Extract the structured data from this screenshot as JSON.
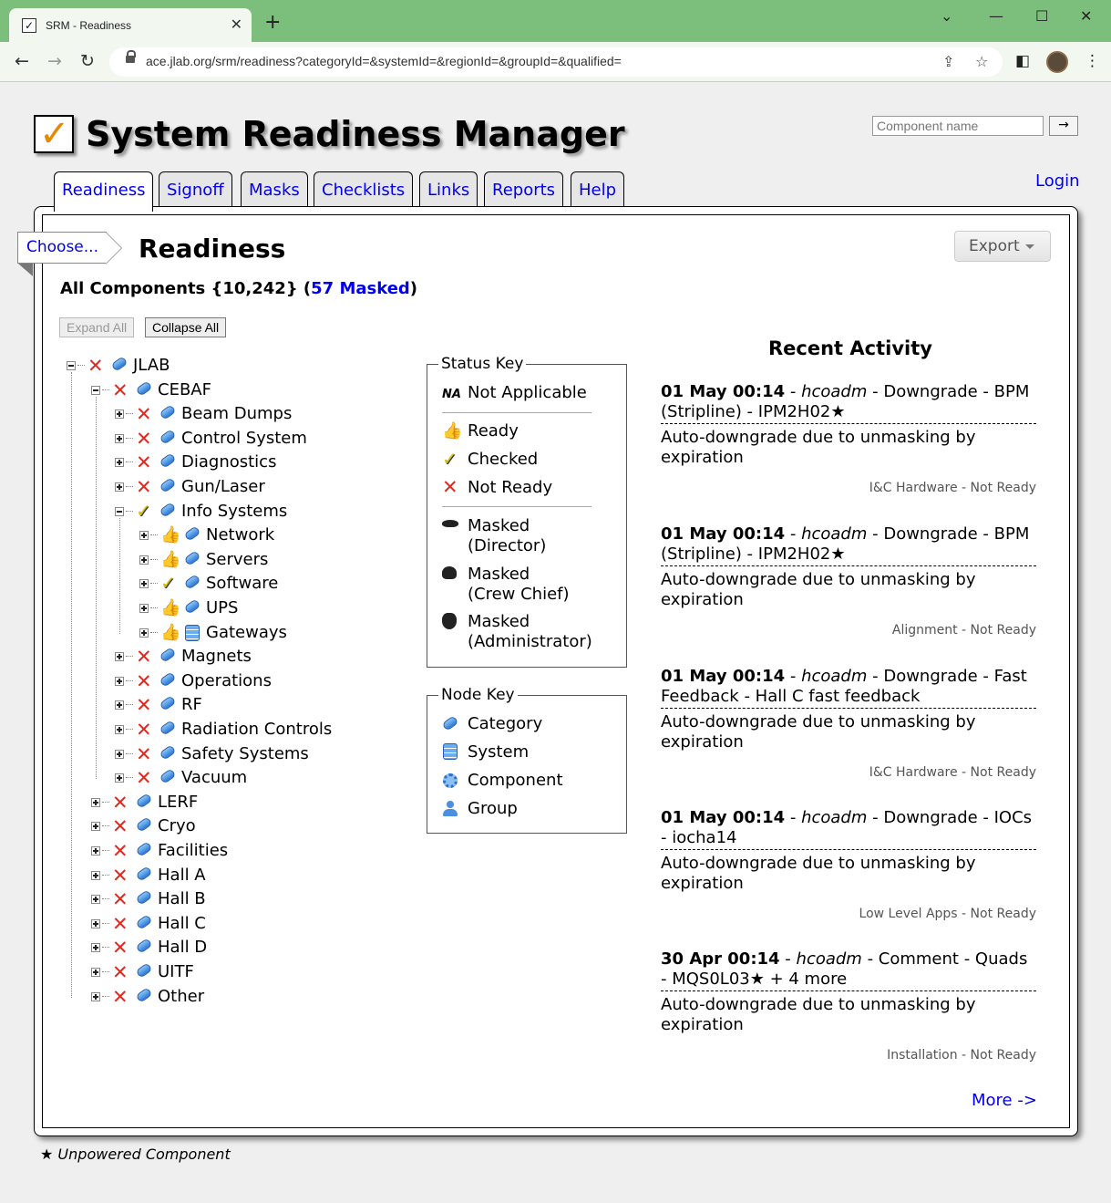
{
  "browser": {
    "tab_title": "SRM - Readiness",
    "tab_close": "✕",
    "new_tab": "+",
    "url": "ace.jlab.org/srm/readiness?categoryId=&systemId=&regionId=&groupId=&qualified="
  },
  "header": {
    "logo_check": "✓",
    "title": "System Readiness Manager",
    "search_placeholder": "Component name",
    "search_go": "→",
    "login": "Login"
  },
  "nav_tabs": [
    "Readiness",
    "Signoff",
    "Masks",
    "Checklists",
    "Links",
    "Reports",
    "Help"
  ],
  "page": {
    "choose": "Choose...",
    "heading": "Readiness",
    "export": "Export",
    "summary_prefix": "All Components {10,242} (",
    "summary_masked": "57 Masked",
    "summary_suffix": ")",
    "expand_all": "Expand All",
    "collapse_all": "Collapse All"
  },
  "tree": [
    {
      "label": "JLAB",
      "status": "not-ready",
      "type": "category",
      "level": 0,
      "expanded": true
    },
    {
      "label": "CEBAF",
      "status": "not-ready",
      "type": "category",
      "level": 1,
      "expanded": true
    },
    {
      "label": "Beam Dumps",
      "status": "not-ready",
      "type": "category",
      "level": 2
    },
    {
      "label": "Control System",
      "status": "not-ready",
      "type": "category",
      "level": 2
    },
    {
      "label": "Diagnostics",
      "status": "not-ready",
      "type": "category",
      "level": 2
    },
    {
      "label": "Gun/Laser",
      "status": "not-ready",
      "type": "category",
      "level": 2
    },
    {
      "label": "Info Systems",
      "status": "checked",
      "type": "category",
      "level": 2,
      "expanded": true
    },
    {
      "label": "Network",
      "status": "ready",
      "type": "category",
      "level": 3
    },
    {
      "label": "Servers",
      "status": "ready",
      "type": "category",
      "level": 3
    },
    {
      "label": "Software",
      "status": "checked",
      "type": "category",
      "level": 3
    },
    {
      "label": "UPS",
      "status": "ready",
      "type": "category",
      "level": 3
    },
    {
      "label": "Gateways",
      "status": "ready",
      "type": "system",
      "level": 3
    },
    {
      "label": "Magnets",
      "status": "not-ready",
      "type": "category",
      "level": 2
    },
    {
      "label": "Operations",
      "status": "not-ready",
      "type": "category",
      "level": 2
    },
    {
      "label": "RF",
      "status": "not-ready",
      "type": "category",
      "level": 2
    },
    {
      "label": "Radiation Controls",
      "status": "not-ready",
      "type": "category",
      "level": 2
    },
    {
      "label": "Safety Systems",
      "status": "not-ready",
      "type": "category",
      "level": 2
    },
    {
      "label": "Vacuum",
      "status": "not-ready",
      "type": "category",
      "level": 2
    },
    {
      "label": "LERF",
      "status": "not-ready",
      "type": "category",
      "level": 1
    },
    {
      "label": "Cryo",
      "status": "not-ready",
      "type": "category",
      "level": 1
    },
    {
      "label": "Facilities",
      "status": "not-ready",
      "type": "category",
      "level": 1
    },
    {
      "label": "Hall A",
      "status": "not-ready",
      "type": "category",
      "level": 1
    },
    {
      "label": "Hall B",
      "status": "not-ready",
      "type": "category",
      "level": 1
    },
    {
      "label": "Hall C",
      "status": "not-ready",
      "type": "category",
      "level": 1
    },
    {
      "label": "Hall D",
      "status": "not-ready",
      "type": "category",
      "level": 1
    },
    {
      "label": "UITF",
      "status": "not-ready",
      "type": "category",
      "level": 1
    },
    {
      "label": "Other",
      "status": "not-ready",
      "type": "category",
      "level": 1
    }
  ],
  "status_key": {
    "legend": "Status Key",
    "na_icon": "NA",
    "not_applicable": "Not Applicable",
    "ready": "Ready",
    "checked": "Checked",
    "not_ready": "Not Ready",
    "masked_director_1": "Masked",
    "masked_director_2": "(Director)",
    "masked_crew_1": "Masked",
    "masked_crew_2": "(Crew Chief)",
    "masked_admin_1": "Masked",
    "masked_admin_2": "(Administrator)"
  },
  "node_key": {
    "legend": "Node Key",
    "category": "Category",
    "system": "System",
    "component": "Component",
    "group": "Group"
  },
  "recent_activity": {
    "title": "Recent Activity",
    "items": [
      {
        "time": "01 May 00:14",
        "user": "hcoadm",
        "action": "Downgrade - BPM (Stripline) - IPM2H02★",
        "comment": "Auto-downgrade due to unmasking by expiration",
        "meta": "I&C Hardware - Not Ready"
      },
      {
        "time": "01 May 00:14",
        "user": "hcoadm",
        "action": "Downgrade - BPM (Stripline) - IPM2H02★",
        "comment": "Auto-downgrade due to unmasking by expiration",
        "meta": "Alignment - Not Ready"
      },
      {
        "time": "01 May 00:14",
        "user": "hcoadm",
        "action": "Downgrade - Fast Feedback - Hall C fast feedback",
        "comment": "Auto-downgrade due to unmasking by expiration",
        "meta": "I&C Hardware - Not Ready"
      },
      {
        "time": "01 May 00:14",
        "user": "hcoadm",
        "action": "Downgrade - IOCs - iocha14",
        "comment": "Auto-downgrade due to unmasking by expiration",
        "meta": "Low Level Apps - Not Ready"
      },
      {
        "time": "30 Apr 00:14",
        "user": "hcoadm",
        "action": "Comment - Quads - MQS0L03★ + 4 more",
        "comment": "Auto-downgrade due to unmasking by expiration",
        "meta": "Installation - Not Ready"
      }
    ],
    "more": "More ->"
  },
  "footnote": "★ Unpowered Component",
  "colors": {
    "accent_link": "#0000ee",
    "titlebar": "#7cbe7c",
    "not_ready": "#e0281e",
    "ready": "#3aa040",
    "checked": "#d6c200"
  }
}
